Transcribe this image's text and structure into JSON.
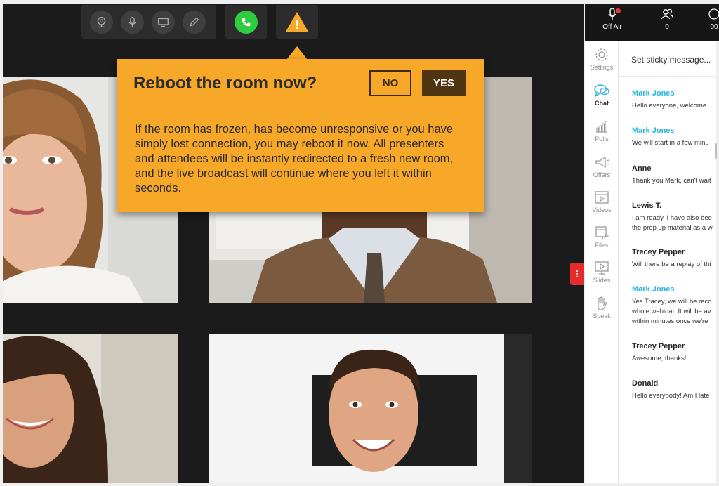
{
  "toolbar": {
    "icons": [
      "webcam-icon",
      "microphone-icon",
      "screen-share-icon",
      "pencil-icon",
      "phone-icon",
      "warning-icon"
    ],
    "call_color": "#2ecc40",
    "warning_color": "#f7a829"
  },
  "popup": {
    "title": "Reboot the room now?",
    "no_label": "NO",
    "yes_label": "YES",
    "body": "If the room has frozen, has become unresponsive or you have simply lost connection, you may reboot it now. All presenters and attendees will be instantly redirected to a fresh new room, and the live broadcast will continue where you left it within seconds.",
    "background": "#f7a829"
  },
  "header": {
    "off_air_label": "Off Air",
    "attendee_count": "0",
    "extra_count": "00"
  },
  "rail": {
    "items": [
      {
        "label": "Settings",
        "icon": "gear-icon"
      },
      {
        "label": "Chat",
        "icon": "chat-icon",
        "active": true
      },
      {
        "label": "Polls",
        "icon": "bar-chart-icon"
      },
      {
        "label": "Offers",
        "icon": "megaphone-icon"
      },
      {
        "label": "Videos",
        "icon": "video-icon"
      },
      {
        "label": "Files",
        "icon": "files-icon"
      },
      {
        "label": "Slides",
        "icon": "slides-icon"
      },
      {
        "label": "Speak",
        "icon": "hand-icon"
      }
    ]
  },
  "chat": {
    "sticky_placeholder": "Set sticky message...",
    "messages": [
      {
        "name": "Mark Jones",
        "host": true,
        "lines": [
          "Hello everyone, welcome"
        ]
      },
      {
        "name": "Mark Jones",
        "host": true,
        "lines": [
          "We will start in a few minu"
        ]
      },
      {
        "name": "Anne",
        "host": false,
        "lines": [
          "Thank you Mark, can't wait"
        ]
      },
      {
        "name": "Lewis T.",
        "host": false,
        "lines": [
          "I am ready. I have also bee",
          "the prep up material as a w"
        ]
      },
      {
        "name": "Trecey Pepper",
        "host": false,
        "lines": [
          "Will there be a replay of thi"
        ]
      },
      {
        "name": "Mark Jones",
        "host": true,
        "lines": [
          "Yes Tracey, we will be reco",
          "whole webinar. It will be av",
          "within minutes once we're"
        ]
      },
      {
        "name": "Trecey Pepper",
        "host": false,
        "lines": [
          "Awesome, thanks!"
        ]
      },
      {
        "name": "Donald",
        "host": false,
        "lines": [
          "Hello everybody! Am I late"
        ]
      }
    ]
  }
}
